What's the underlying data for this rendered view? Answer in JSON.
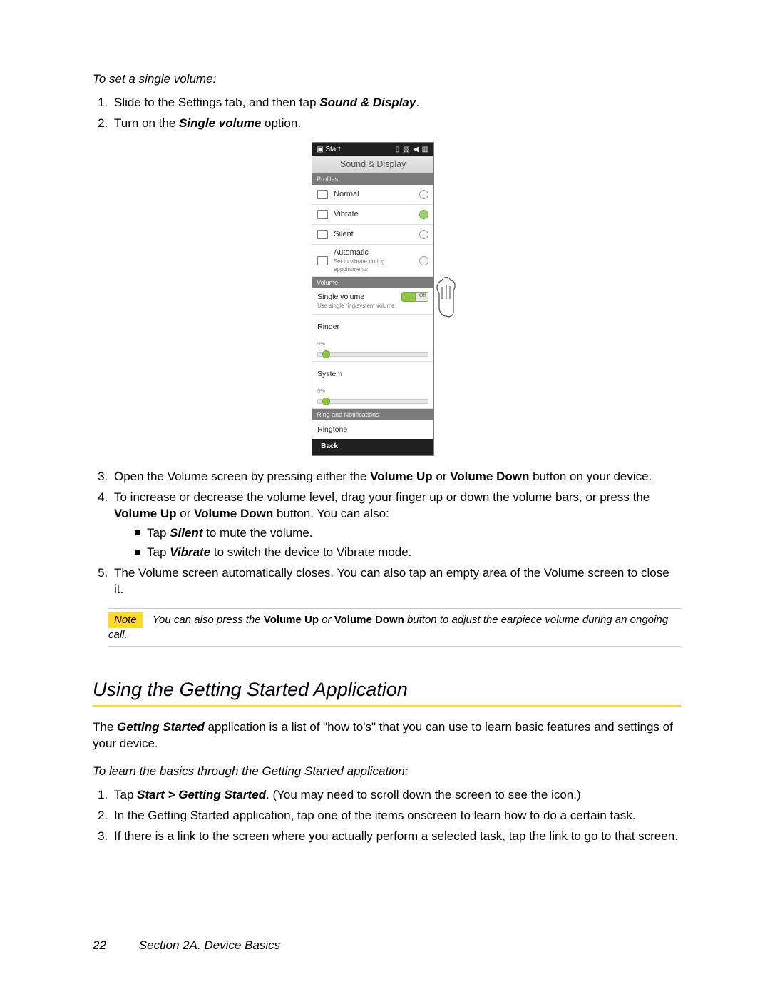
{
  "head1": "To set a single volume:",
  "steps_a": {
    "s1": {
      "pre": "Slide to the Settings tab, and then tap ",
      "em": "Sound & Display",
      "post": "."
    },
    "s2": {
      "pre": "Turn on the ",
      "em": "Single volume",
      "post": " option."
    }
  },
  "device": {
    "start": "Start",
    "status_icons": "▯ ▧ ◀  ▥",
    "title": "Sound & Display",
    "hdr_profiles": "Profiles",
    "normal": "Normal",
    "vibrate": "Vibrate",
    "silent": "Silent",
    "automatic": "Automatic",
    "auto_sub": "Set to vibrate during appointments",
    "hdr_volume": "Volume",
    "sv_title": "Single volume",
    "sv_sub": "Use single ring/system volume",
    "toggle": "Off",
    "ringer": "Ringer",
    "ringer_pct": "0%",
    "system": "System",
    "system_pct": "0%",
    "hdr_ring": "Ring and Notifications",
    "ringtone": "Ringtone",
    "back": "Back"
  },
  "steps_b": {
    "s3": {
      "pre": "Open the Volume screen by pressing either the ",
      "b1": "Volume Up",
      "mid": " or ",
      "b2": "Volume Down",
      "post": " button on your device."
    },
    "s4": {
      "pre": "To increase or decrease the volume level, drag your finger up or down the volume bars, or press the ",
      "b1": "Volume Up",
      "mid": " or ",
      "b2": "Volume Down",
      "post": " button. You can also:"
    },
    "sub1": {
      "pre": "Tap ",
      "em": "Silent",
      "post": " to mute the volume."
    },
    "sub2": {
      "pre": "Tap ",
      "em": "Vibrate",
      "post": " to switch the device to Vibrate mode."
    },
    "s5": "The Volume screen automatically closes. You can also tap an empty area of the Volume screen to close it."
  },
  "note": {
    "tag": "Note",
    "pre": "You can also press the ",
    "b1": "Volume Up",
    "mid": " or ",
    "b2": "Volume Down",
    "post": " button to adjust the earpiece volume during an ongoing call."
  },
  "section_title": "Using the Getting Started Application",
  "section_intro": {
    "pre": "The ",
    "em": "Getting Started",
    "post": " application is a list of \"how to's\" that you can use to learn basic features and settings of your device."
  },
  "head2": "To learn the basics through the Getting Started application:",
  "steps_c": {
    "s1": {
      "pre": "Tap ",
      "em": "Start > Getting Started",
      "post": ". (You may need to scroll down the screen to see the icon.)"
    },
    "s2": "In the Getting Started application, tap one of the items onscreen to learn how to do a certain task.",
    "s3": "If there is a link to the screen where you actually perform a selected task, tap the link to go to that screen."
  },
  "footer": {
    "page": "22",
    "label": "Section 2A. Device Basics"
  }
}
